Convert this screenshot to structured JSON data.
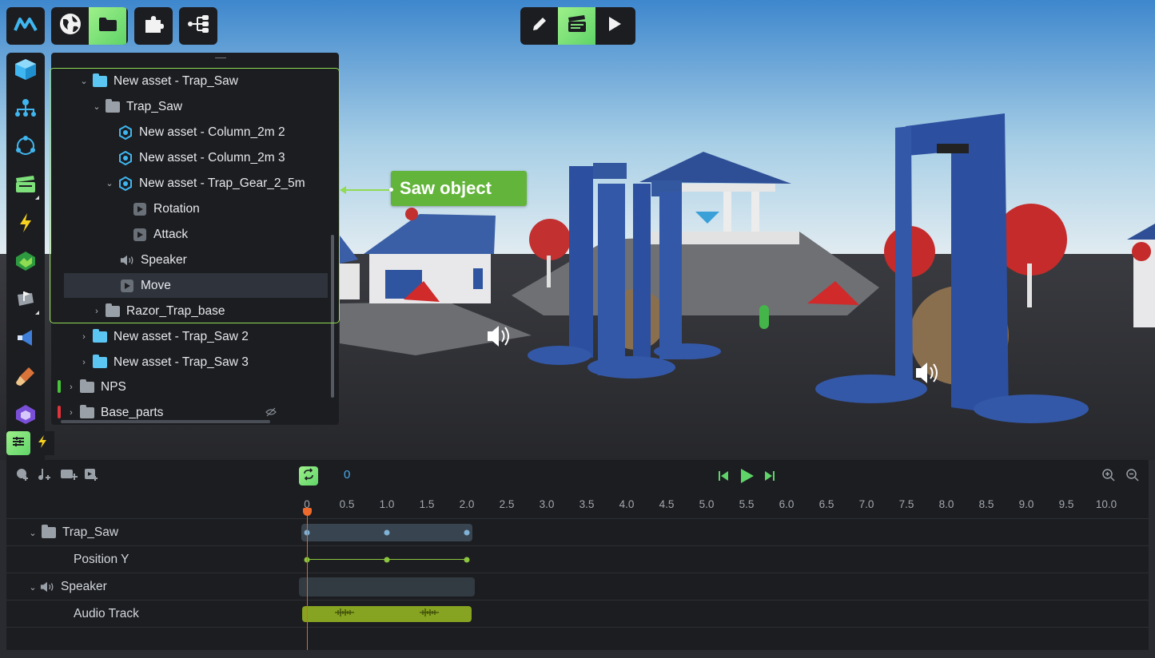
{
  "app": {
    "logo_icon": "m-logo-icon"
  },
  "top_toolbar": {
    "left_group": [
      {
        "name": "world-icon",
        "active": false
      },
      {
        "name": "folder-icon",
        "active": true
      }
    ],
    "plugins_icon": "puzzle-icon",
    "graph_icon": "node-graph-icon",
    "mode_group": [
      {
        "name": "pencil-icon",
        "active": false
      },
      {
        "name": "clapperboard-icon",
        "active": true
      },
      {
        "name": "play-icon",
        "active": false
      }
    ]
  },
  "left_rail": {
    "items": [
      "cube-icon",
      "hierarchy-icon",
      "cycle-icon",
      "clapper-icon",
      "lightning-icon",
      "terrain-icon",
      "flag-icon",
      "megaphone-icon",
      "brush-icon",
      "purple-cube-icon"
    ]
  },
  "hierarchy": {
    "rows": [
      {
        "label": "New asset - Trap_Saw",
        "icon": "folder-cyan",
        "expanded": true
      },
      {
        "label": "Trap_Saw",
        "icon": "folder-grey",
        "expanded": true
      },
      {
        "label": "New asset - Column_2m 2",
        "icon": "asset"
      },
      {
        "label": "New asset - Column_2m 3",
        "icon": "asset"
      },
      {
        "label": "New asset - Trap_Gear_2_5m",
        "icon": "asset",
        "expanded": true
      },
      {
        "label": "Rotation",
        "icon": "animation"
      },
      {
        "label": "Attack",
        "icon": "animation"
      },
      {
        "label": "Speaker",
        "icon": "speaker"
      },
      {
        "label": "Move",
        "icon": "animation",
        "selected": true
      },
      {
        "label": "Razor_Trap_base",
        "icon": "folder-grey",
        "expanded": false
      },
      {
        "label": "New asset - Trap_Saw 2",
        "icon": "folder-cyan",
        "expanded": false
      },
      {
        "label": "New asset - Trap_Saw 3",
        "icon": "folder-cyan",
        "expanded": false
      },
      {
        "label": "NPS",
        "icon": "folder-grey",
        "expanded": false,
        "flag": "#49c33a"
      },
      {
        "label": "Base_parts",
        "icon": "folder-grey",
        "expanded": false,
        "flag": "#e0333b"
      }
    ]
  },
  "callout": {
    "text": "Saw object"
  },
  "timeline": {
    "top_icons": [
      "add-object-icon",
      "add-audio-icon",
      "add-video-icon",
      "add-clip-icon"
    ],
    "current_frame": "0",
    "transport": [
      "skip-back-icon",
      "play-icon",
      "skip-forward-icon"
    ],
    "zoom": [
      "zoom-in-icon",
      "zoom-out-icon"
    ],
    "ticks": [
      "0",
      "0.5",
      "1.0",
      "1.5",
      "2.0",
      "2.5",
      "3.0",
      "3.5",
      "4.0",
      "4.5",
      "5.0",
      "5.5",
      "6.0",
      "6.5",
      "7.0",
      "7.5",
      "8.0",
      "8.5",
      "9.0",
      "9.5",
      "10.0"
    ],
    "tracks": [
      {
        "label": "Trap_Saw",
        "type": "group",
        "keyframes": [
          0,
          1.0,
          2.0
        ]
      },
      {
        "label": "Position Y",
        "type": "property",
        "keyframes": [
          0,
          1.0,
          2.0
        ]
      },
      {
        "label": "Speaker",
        "type": "group"
      },
      {
        "label": "Audio Track",
        "type": "audio",
        "start": 0,
        "end": 2.0
      }
    ],
    "playhead_time": 0
  },
  "colors": {
    "accent_green": "#8fdb52",
    "callout_green": "#62b43a",
    "frame_blue": "#4aa8e8",
    "playhead_orange": "#e0652b",
    "keyframe_green": "#8cc63f",
    "keyframe_blue": "#7fb2d6",
    "audio_clip": "#86a321"
  }
}
